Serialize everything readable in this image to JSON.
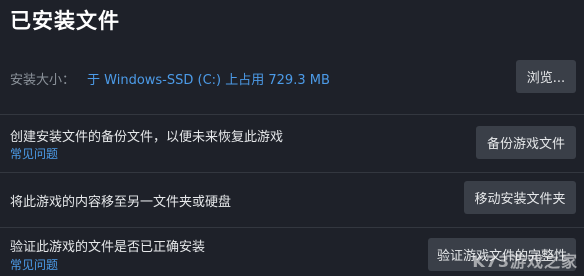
{
  "header": {
    "title": "已安装文件"
  },
  "install_size": {
    "label": "安装大小：",
    "value": "于 Windows-SSD (C:) 上占用 729.3 MB",
    "button": "浏览..."
  },
  "backup": {
    "label": "创建安装文件的备份文件，以便未来恢复此游戏",
    "faq": "常见问题",
    "button": "备份游戏文件"
  },
  "move": {
    "label": "将此游戏的内容移至另一文件夹或硬盘",
    "button": "移动安装文件夹"
  },
  "verify": {
    "label": "验证此游戏的文件是否已正确安装",
    "faq": "常见问题",
    "button": "验证游戏文件的完整性"
  },
  "watermark": "K73游戏之家"
}
